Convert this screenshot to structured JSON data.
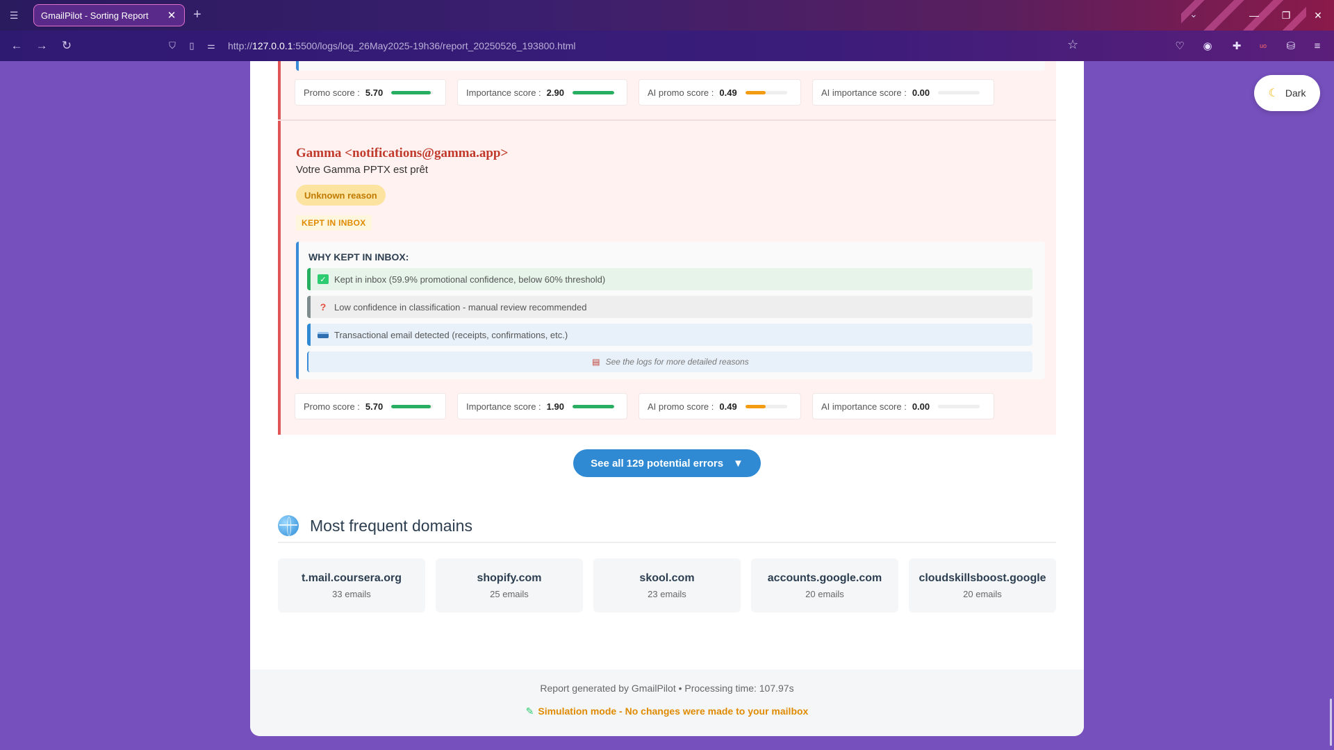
{
  "browser": {
    "tab_title": "GmailPilot - Sorting Report",
    "url_prefix": "http://",
    "url_host": "127.0.0.1",
    "url_rest": ":5500/logs/log_26May2025-19h36/report_20250526_193800.html"
  },
  "theme_toggle": {
    "label": "Dark"
  },
  "previous_email": {
    "scores": [
      {
        "label": "Promo score :",
        "value": "5.70",
        "fill": 0.95,
        "color": "#27ae60"
      },
      {
        "label": "Importance score :",
        "value": "2.90",
        "fill": 1.0,
        "color": "#27ae60"
      },
      {
        "label": "AI promo score :",
        "value": "0.49",
        "fill": 0.49,
        "color": "#f39c12"
      },
      {
        "label": "AI importance score :",
        "value": "0.00",
        "fill": 0.0,
        "color": "#27ae60"
      }
    ]
  },
  "email": {
    "sender": "Gamma <notifications@gamma.app>",
    "subject": "Votre Gamma PPTX est prêt",
    "reason_badge": "Unknown reason",
    "status": "KEPT IN INBOX",
    "why_title": "WHY KEPT IN INBOX:",
    "why_items": [
      {
        "icon": "check-icon",
        "text": "Kept in inbox (59.9% promotional confidence, below 60% threshold)",
        "bg": "#e6f4ea",
        "border": "#27ae60"
      },
      {
        "icon": "question-icon",
        "text": "Low confidence in classification - manual review recommended",
        "bg": "#eeeeee",
        "border": "#7f8c8d"
      },
      {
        "icon": "card-icon",
        "text": "Transactional email detected (receipts, confirmations, etc.)",
        "bg": "#e8f1fa",
        "border": "#2f8ad3"
      }
    ],
    "logs_note": "See the logs for more detailed reasons",
    "scores": [
      {
        "label": "Promo score :",
        "value": "5.70",
        "fill": 0.95,
        "color": "#27ae60"
      },
      {
        "label": "Importance score :",
        "value": "1.90",
        "fill": 1.0,
        "color": "#27ae60"
      },
      {
        "label": "AI promo score :",
        "value": "0.49",
        "fill": 0.49,
        "color": "#f39c12"
      },
      {
        "label": "AI importance score :",
        "value": "0.00",
        "fill": 0.0,
        "color": "#27ae60"
      }
    ]
  },
  "see_all_button": {
    "label": "See all 129 potential errors",
    "arrow": "▼"
  },
  "domains_section": {
    "title": "Most frequent domains",
    "items": [
      {
        "name": "t.mail.coursera.org",
        "count": "33 emails"
      },
      {
        "name": "shopify.com",
        "count": "25 emails"
      },
      {
        "name": "skool.com",
        "count": "23 emails"
      },
      {
        "name": "accounts.google.com",
        "count": "20 emails"
      },
      {
        "name": "cloudskillsboost.google",
        "count": "20 emails"
      }
    ]
  },
  "footer": {
    "generated": "Report generated by GmailPilot • Processing time: 107.97s",
    "simulation": "Simulation mode - No changes were made to your mailbox"
  }
}
